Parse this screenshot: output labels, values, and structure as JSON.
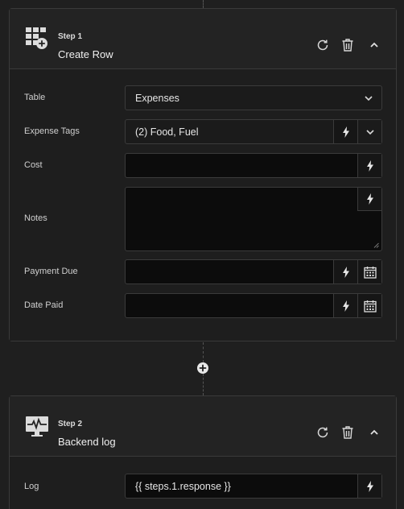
{
  "step1": {
    "number": "Step 1",
    "title": "Create Row",
    "icon": "table-add-icon",
    "fields": {
      "table": {
        "label": "Table",
        "value": "Expenses"
      },
      "expense_tags": {
        "label": "Expense Tags",
        "value": "(2) Food, Fuel"
      },
      "cost": {
        "label": "Cost",
        "value": ""
      },
      "notes": {
        "label": "Notes",
        "value": ""
      },
      "payment_due": {
        "label": "Payment Due",
        "value": ""
      },
      "date_paid": {
        "label": "Date Paid",
        "value": ""
      }
    }
  },
  "step2": {
    "number": "Step 2",
    "title": "Backend log",
    "icon": "monitor-activity-icon",
    "fields": {
      "log": {
        "label": "Log",
        "value": "{{ steps.1.response }}"
      }
    }
  },
  "icons": [
    "refresh-icon",
    "trash-icon",
    "chevron-up-icon",
    "bolt-icon",
    "chevron-down-icon",
    "calendar-icon",
    "plus-icon"
  ]
}
